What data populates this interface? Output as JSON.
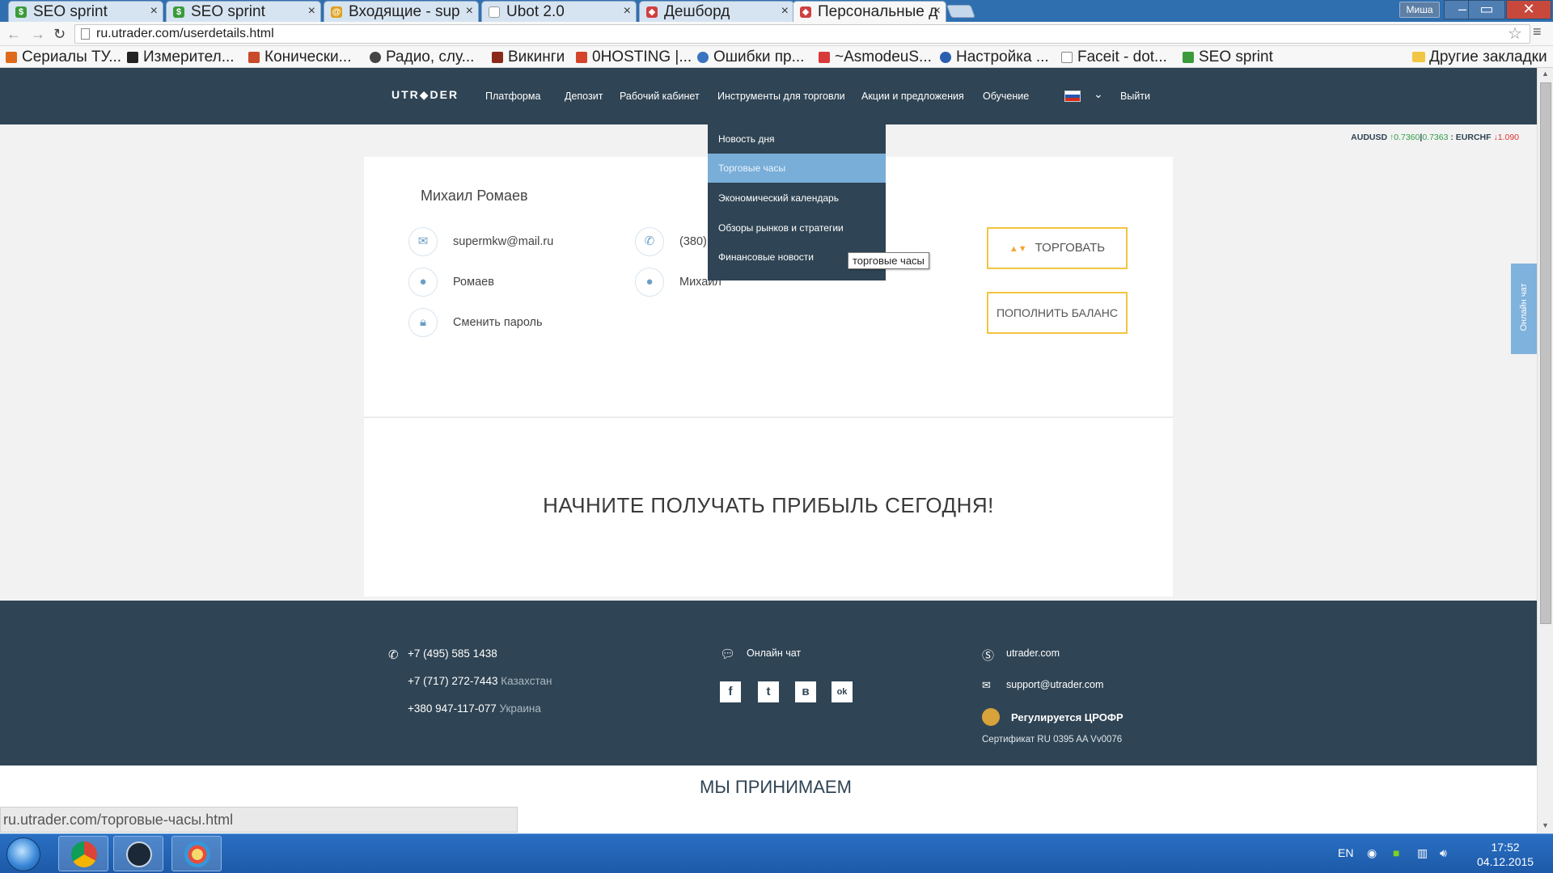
{
  "browser": {
    "tabs": [
      {
        "title": "SEO sprint",
        "favicon_color": "#3a9b3a"
      },
      {
        "title": "SEO sprint",
        "favicon_color": "#3a9b3a"
      },
      {
        "title": "Входящие - sup",
        "favicon_color": "#e0a020"
      },
      {
        "title": "Ubot 2.0",
        "favicon_color": "#777777"
      },
      {
        "title": "Дешборд",
        "favicon_color": "#d04040"
      },
      {
        "title": "Персональные д",
        "favicon_color": "#d04040"
      }
    ],
    "tab_close_glyph": "×",
    "user_badge": "Миша",
    "window_controls": {
      "minimize": "–",
      "maximize": "▭",
      "close": "✕"
    },
    "url": "ru.utrader.com/userdetails.html",
    "bookmarks": [
      {
        "label": "Сериалы ТУ...",
        "color": "#e06a1b"
      },
      {
        "label": "Измерител...",
        "color": "#222222"
      },
      {
        "label": "Конически...",
        "color": "#c84a2a"
      },
      {
        "label": "Радио, слу...",
        "color": "#444444"
      },
      {
        "label": "Викинги",
        "color": "#8b2a1a"
      },
      {
        "label": "0HOSTING |...",
        "color": "#d4442a"
      },
      {
        "label": "Ошибки пр...",
        "color": "#3a73c0"
      },
      {
        "label": "~AsmodeuS...",
        "color": "#d83a3a"
      },
      {
        "label": "Настройка ...",
        "color": "#2a5fb0"
      },
      {
        "label": "Faceit - dot...",
        "color": "#888888"
      },
      {
        "label": "SEO sprint",
        "color": "#3a9b3a"
      }
    ],
    "other_bookmarks": "Другие закладки",
    "status_url": "ru.utrader.com/торговые-часы.html"
  },
  "site": {
    "logo": "UTR◆DER",
    "nav": [
      "Платформа",
      "Депозит",
      "Рабочий кабинет",
      "Инструменты для торговли",
      "Акции и предложения",
      "Обучение"
    ],
    "logout": "Выйти",
    "ticker": {
      "pair1": "AUDUSD",
      "bid1": "↑0.7360",
      "ask1": "0.7363",
      "pair2": "EURCHF",
      "bid2": "↓1.090"
    },
    "dropdown": [
      "Новость дня",
      "Торговые часы",
      "Экономический календарь",
      "Обзоры рынков и стратегии",
      "Финансовые новости"
    ],
    "tooltip": "торговые часы",
    "profile": {
      "name": "Михаил Ромаев",
      "email": "supermkw@mail.ru",
      "phone": "(380)",
      "last_name": "Ромаев",
      "first_name": "Михаил",
      "change_password": "Сменить пароль"
    },
    "buttons": {
      "trade": "ТОРГОВАТЬ",
      "trade_arrows": "▲▼",
      "deposit": "ПОПОЛНИТЬ БАЛАНС"
    },
    "promo": "НАЧНИТЕ ПОЛУЧАТЬ ПРИБЫЛЬ СЕГОДНЯ!",
    "chat_tab": "Онлайн чат",
    "footer": {
      "phone1": "+7 (495) 585 1438",
      "phone2": "+7 (717) 272-7443",
      "phone2_country": "Казахстан",
      "phone3": "+380 947-117-077",
      "phone3_country": "Украина",
      "online_chat": "Онлайн чат",
      "social": [
        "f",
        "t",
        "в",
        "ok"
      ],
      "skype": "utrader.com",
      "email": "support@utrader.com",
      "regulated": "Регулируется ЦРОФР",
      "certificate": "Сертификат RU 0395 AA Vv0076"
    },
    "we_accept": "МЫ ПРИНИМАЕМ"
  },
  "taskbar": {
    "lang": "EN",
    "time": "17:52",
    "date": "04.12.2015"
  }
}
